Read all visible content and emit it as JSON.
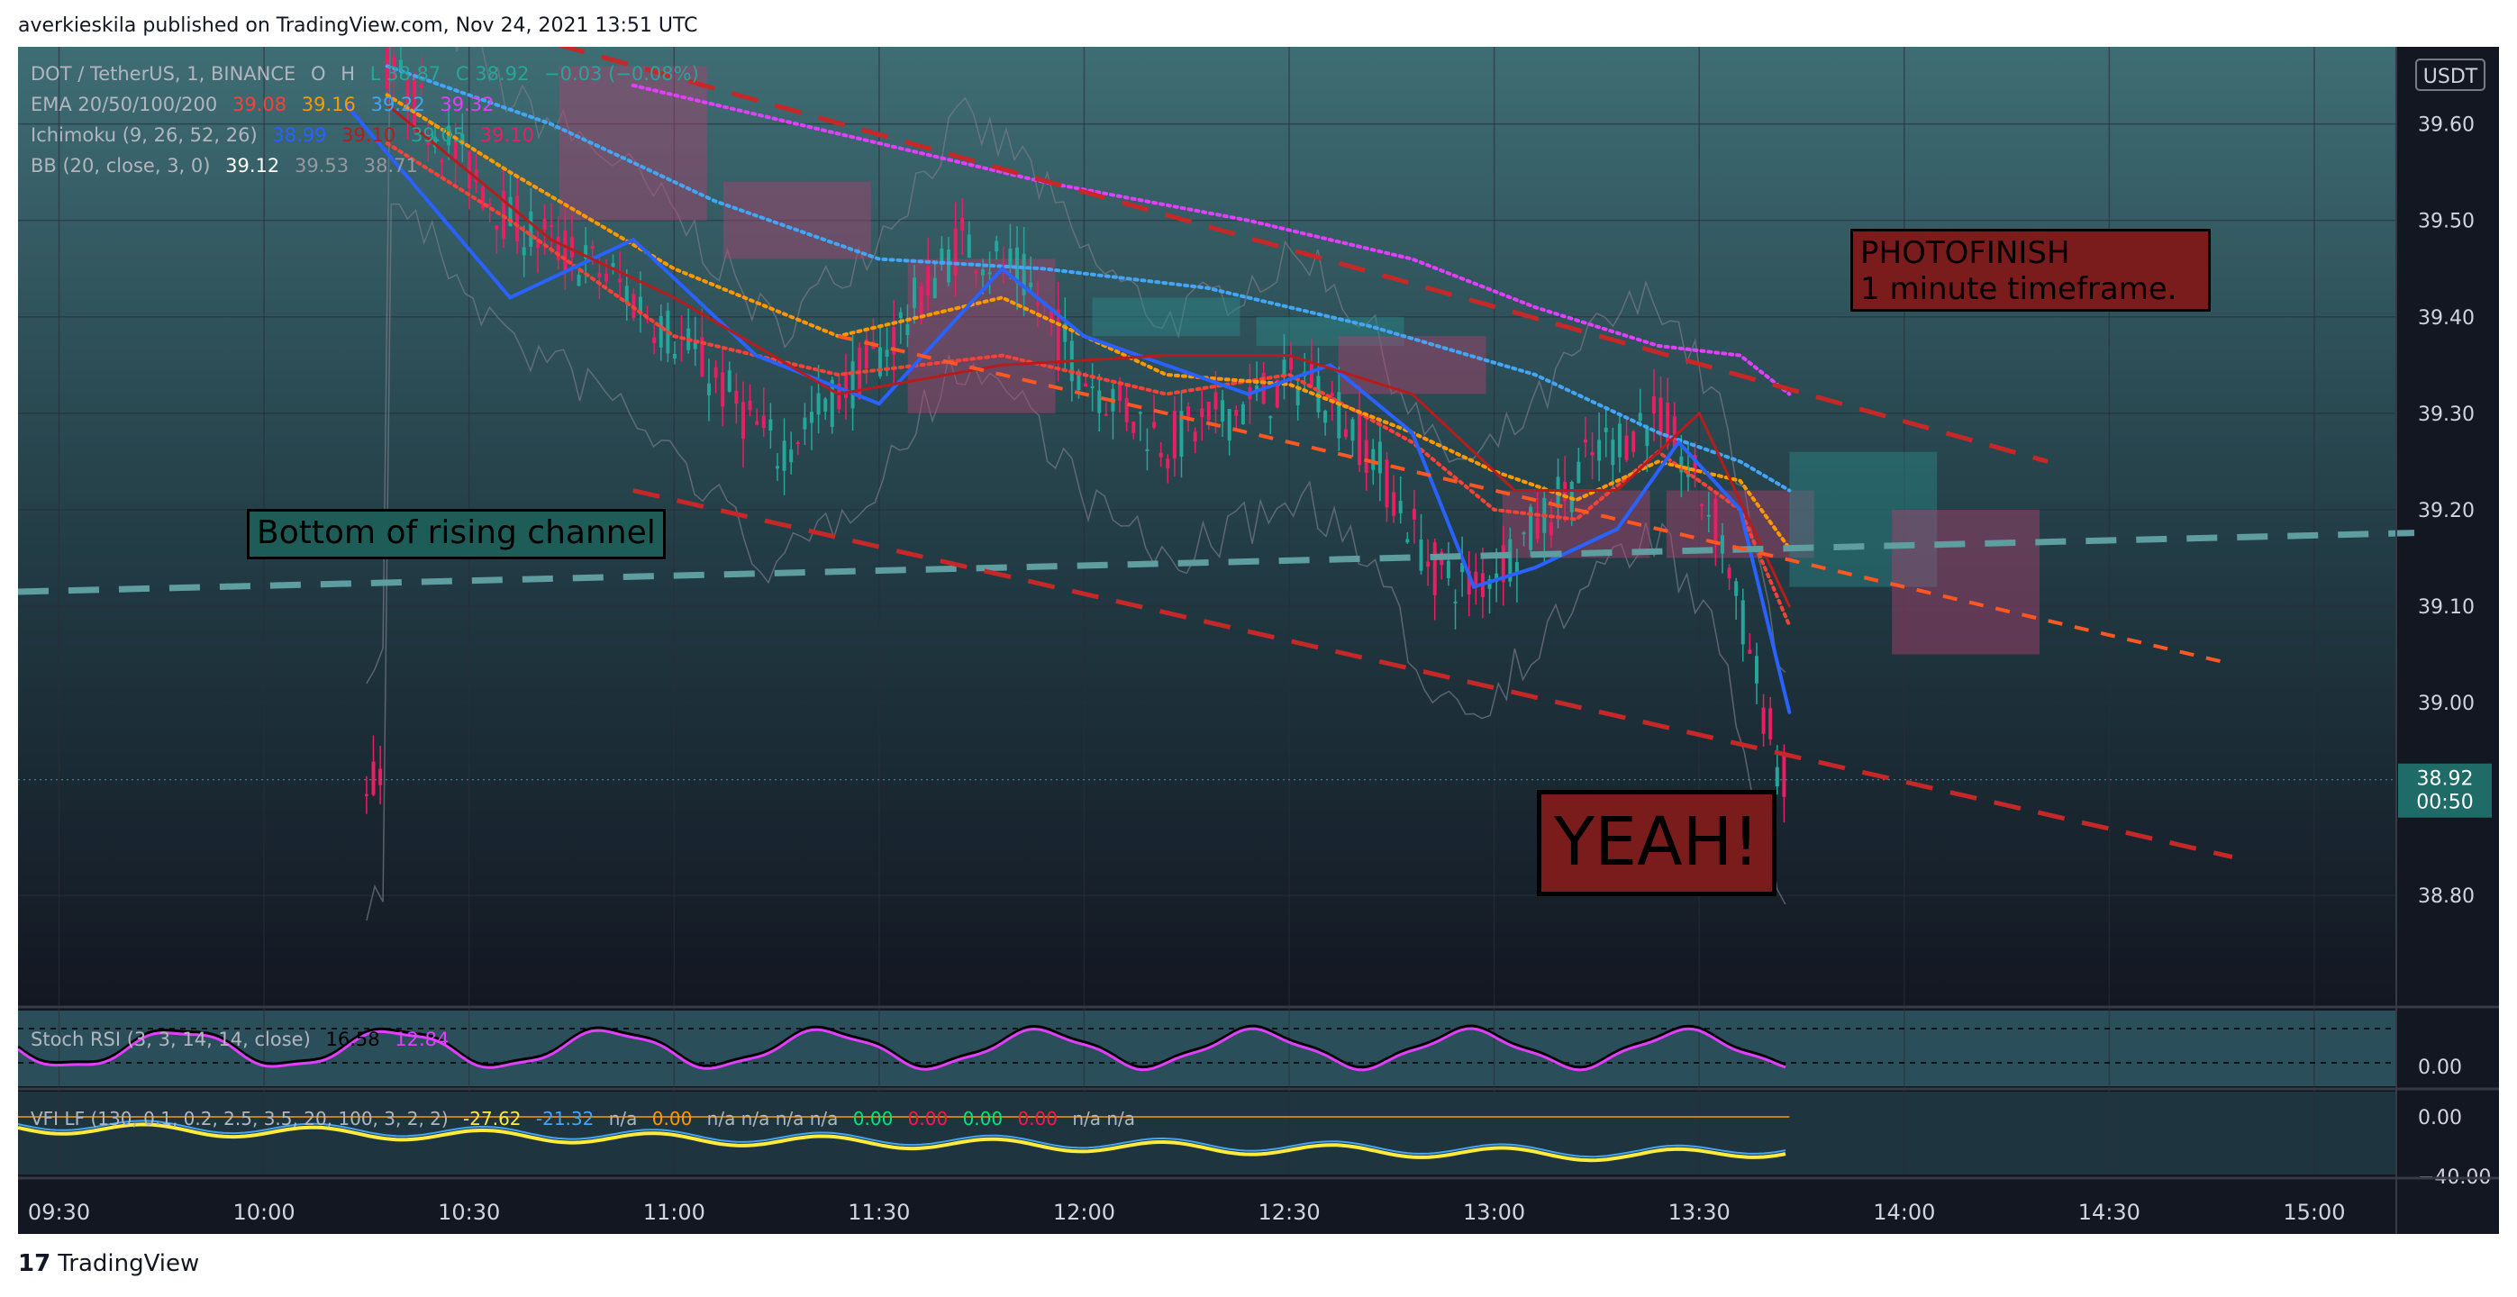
{
  "header": {
    "text": "averkieskila published on TradingView.com, Nov 24, 2021 13:51 UTC"
  },
  "legend": {
    "symbol": {
      "label": "DOT / TetherUS, 1, BINANCE",
      "o": "O",
      "h": "H",
      "l": "L 38.87",
      "c": "C 38.92",
      "chg": "−0.03 (−0.08%)"
    },
    "ema": {
      "label": "EMA 20/50/100/200",
      "v1": "39.08",
      "v2": "39.16",
      "v3": "39.22",
      "v4": "39.32"
    },
    "ichimoku": {
      "label": "Ichimoku (9, 26, 52, 26)",
      "v1": "38.99",
      "v2": "39.10",
      "v3": "39.05",
      "v4": "39.10"
    },
    "bb": {
      "label": "BB (20, close, 3, 0)",
      "v1": "39.12",
      "v2": "39.53",
      "v3": "38.71"
    }
  },
  "annotations": {
    "photofinish_line1": "PHOTOFINISH",
    "photofinish_line2": "1 minute timeframe.",
    "bottom_channel": "Bottom of rising channel",
    "yeah": "YEAH!"
  },
  "price_axis": {
    "currency": "USDT",
    "last_price": "38.92",
    "countdown": "00:50"
  },
  "stoch_rsi": {
    "label": "Stoch RSI (3, 3, 14, 14, close)",
    "k": "16.58",
    "d": "12.84",
    "axis_label": "0.00"
  },
  "vfi": {
    "label": "VFI LF (130, 0.1, 0.2, 2.5, 3.5, 20, 100, 3, 2, 2)",
    "v1": "-27.62",
    "v2": "-21.32",
    "na1": "n/a",
    "v3": "0.00",
    "na2": "n/a n/a n/a n/a",
    "v4": "0.00",
    "v5": "0.00",
    "v6": "0.00",
    "v7": "0.00",
    "na3": "n/a n/a",
    "axis_top": "0.00",
    "axis_bottom": "−40.00"
  },
  "footer": {
    "brand": "TradingView"
  },
  "colors": {
    "background": "#131722",
    "gridline": "#2a2e39",
    "candle_up": "#26a69a",
    "candle_down": "#e91e63",
    "ema20": "#f44336",
    "ema50": "#ff9800",
    "ema100": "#42a5f5",
    "ema200": "#e040fb",
    "tenkan": "#2962ff",
    "kijun": "#b71c1c",
    "cloud_bull": "#2b8a8a",
    "cloud_bear": "#b0406e",
    "bb": "#787b86",
    "stoch_k": "#000000",
    "stoch_d": "#e040fb",
    "vfi_line": "#ffeb3b",
    "vfi_signal": "#42a5f5",
    "channel_red": "#c62828",
    "channel_orange": "#ff5722",
    "channel_teal": "#5f9ea0",
    "box_fill": "#7b1c1c"
  },
  "chart_data": {
    "type": "line",
    "title": "",
    "x_ticks": [
      "09:30",
      "10:00",
      "10:30",
      "11:00",
      "11:30",
      "12:00",
      "12:30",
      "13:00",
      "13:30",
      "14:00",
      "14:30",
      "15:00"
    ],
    "x_tick_hours": [
      9.5,
      10,
      10.5,
      11,
      11.5,
      12,
      12.5,
      13,
      13.5,
      14,
      14.5,
      15
    ],
    "y_ticks": [
      "39.60",
      "39.50",
      "39.40",
      "39.30",
      "39.20",
      "39.10",
      "39.00",
      "38.80"
    ],
    "y_tick_values": [
      39.6,
      39.5,
      39.4,
      39.3,
      39.2,
      39.1,
      39.0,
      38.8
    ],
    "x_range": [
      9.4,
      15.2
    ],
    "ylim": [
      38.69,
      39.68
    ],
    "grid": true,
    "series": [
      {
        "name": "EMA 20",
        "x": [
          10.3,
          10.6,
          11.0,
          11.4,
          11.8,
          12.2,
          12.5,
          12.8,
          13.0,
          13.2,
          13.4,
          13.6,
          13.72
        ],
        "y": [
          39.58,
          39.5,
          39.38,
          39.34,
          39.36,
          39.32,
          39.34,
          39.27,
          39.2,
          39.19,
          39.26,
          39.2,
          39.08
        ]
      },
      {
        "name": "EMA 50",
        "x": [
          10.3,
          10.6,
          11.0,
          11.4,
          11.8,
          12.2,
          12.5,
          12.8,
          13.0,
          13.2,
          13.4,
          13.6,
          13.72
        ],
        "y": [
          39.63,
          39.55,
          39.45,
          39.38,
          39.42,
          39.34,
          39.33,
          39.28,
          39.24,
          39.21,
          39.25,
          39.23,
          39.16
        ]
      },
      {
        "name": "EMA 100",
        "x": [
          10.3,
          10.7,
          11.1,
          11.5,
          11.9,
          12.3,
          12.7,
          13.1,
          13.4,
          13.6,
          13.72
        ],
        "y": [
          39.66,
          39.6,
          39.52,
          39.46,
          39.45,
          39.43,
          39.39,
          39.34,
          39.28,
          39.25,
          39.22
        ]
      },
      {
        "name": "EMA 200",
        "x": [
          10.9,
          11.4,
          11.9,
          12.4,
          12.8,
          13.1,
          13.4,
          13.6,
          13.72
        ],
        "y": [
          39.64,
          39.59,
          39.54,
          39.5,
          39.46,
          39.41,
          39.37,
          39.36,
          39.32
        ]
      },
      {
        "name": "Tenkan",
        "x": [
          10.2,
          10.4,
          10.6,
          10.9,
          11.2,
          11.5,
          11.8,
          12.0,
          12.4,
          12.6,
          12.8,
          12.95,
          13.1,
          13.3,
          13.45,
          13.6,
          13.72
        ],
        "y": [
          39.62,
          39.52,
          39.42,
          39.48,
          39.36,
          39.31,
          39.45,
          39.38,
          39.32,
          39.35,
          39.28,
          39.12,
          39.14,
          39.18,
          39.27,
          39.2,
          38.99
        ]
      },
      {
        "name": "Kijun",
        "x": [
          10.3,
          10.7,
          11.0,
          11.4,
          11.8,
          12.2,
          12.5,
          12.8,
          13.05,
          13.3,
          13.5,
          13.72
        ],
        "y": [
          39.62,
          39.48,
          39.42,
          39.32,
          39.35,
          39.36,
          39.36,
          39.32,
          39.22,
          39.22,
          39.3,
          39.1
        ]
      }
    ],
    "price_line": {
      "value": 38.92
    }
  }
}
